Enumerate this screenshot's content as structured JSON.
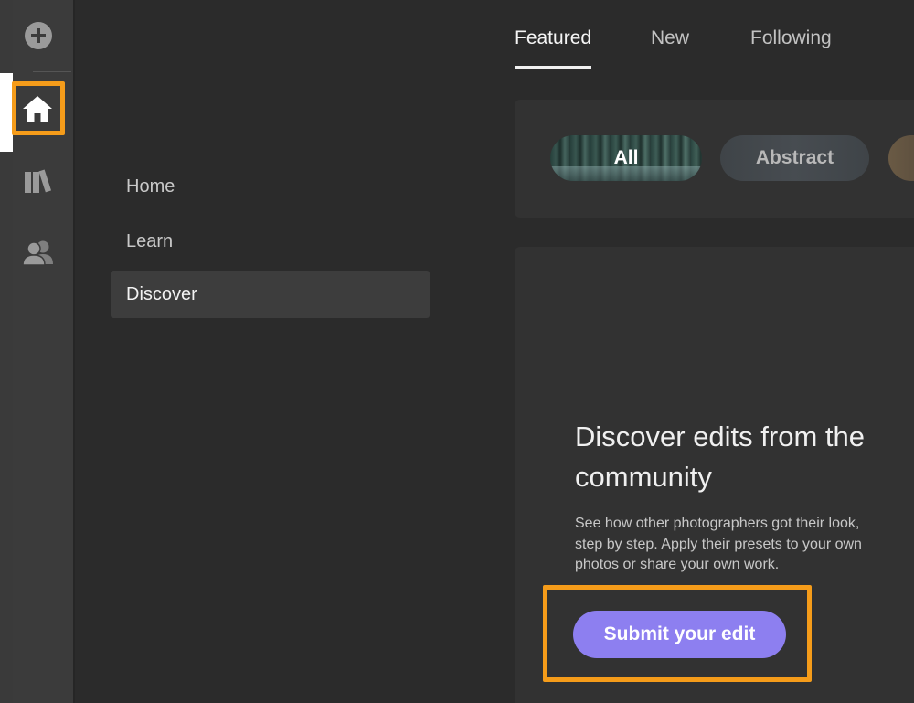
{
  "rail": {
    "items": [
      {
        "icon": "add-icon"
      },
      {
        "icon": "home-icon",
        "selected": true
      },
      {
        "icon": "library-icon"
      },
      {
        "icon": "people-icon"
      }
    ]
  },
  "nav": {
    "items": [
      {
        "label": "Home"
      },
      {
        "label": "Learn"
      },
      {
        "label": "Discover",
        "active": true
      }
    ]
  },
  "tabs": [
    {
      "label": "Featured",
      "active": true
    },
    {
      "label": "New"
    },
    {
      "label": "Following"
    }
  ],
  "filters": [
    {
      "label": "All",
      "selected": true
    },
    {
      "label": "Abstract"
    },
    {
      "label": ""
    }
  ],
  "promo": {
    "title": "Discover edits from the community",
    "description": "See how other photographers got their look, step by step. Apply their presets to your own photos or share your own work.",
    "button_label": "Submit your edit"
  },
  "colors": {
    "accent": "#8d7ff0",
    "highlight": "#f59c1a",
    "background": "#2b2b2b",
    "panel": "#323232",
    "rail": "#3b3b3b"
  }
}
